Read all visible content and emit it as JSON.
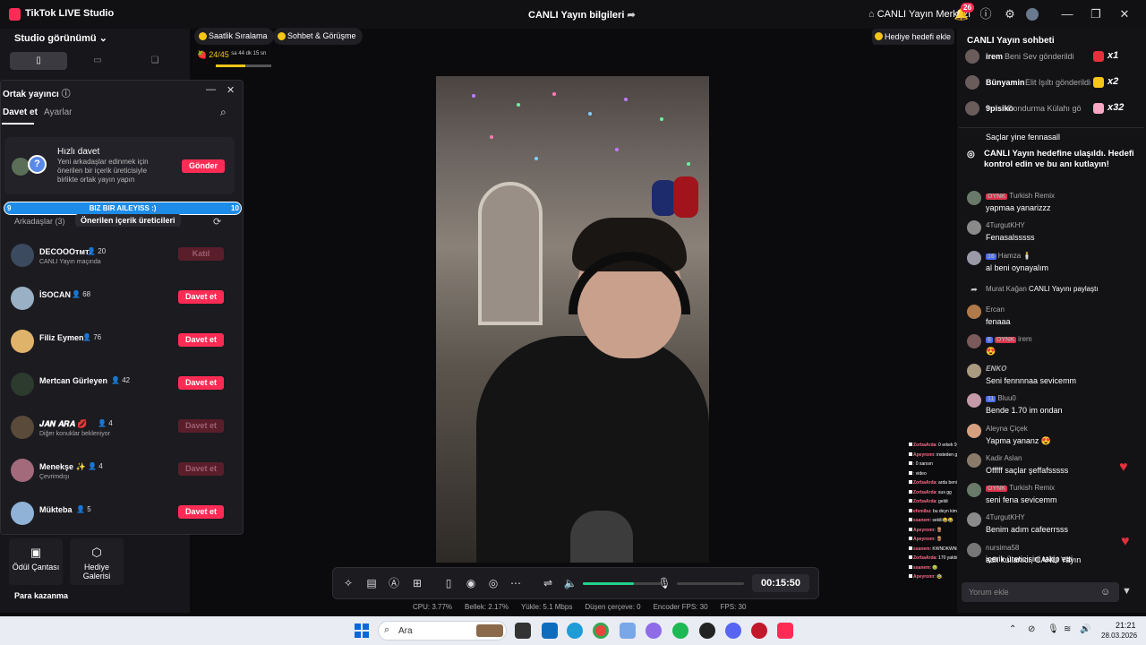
{
  "window": {
    "app_title": "TikTok LIVE Studio",
    "live_info": "CANLI Yayın bilgileri",
    "live_center": "CANLI Yayın Merkezi",
    "notification_count": "26"
  },
  "left": {
    "studio_view": "Studio görünümü",
    "chips": [
      "Saatlik Sıralama",
      "Sohbet & Görüşme"
    ],
    "goal_counter": "24/45",
    "goal_timer": "sa 44 dk 15 sn",
    "goal_progress": 0.53
  },
  "cohost": {
    "title": "Ortak yayıncı",
    "tabs": [
      "Davet et",
      "Ayarlar"
    ],
    "quick_invite": {
      "title": "Hızlı davet",
      "description": "Yeni arkadaşlar edinmek için önerilen bir içerik üreticisiyle birlikte ortak yayın yapın",
      "button": "Gönder"
    },
    "family_bar": {
      "label": "BIZ BIR AILEYISS :)",
      "left": "9",
      "right": "10"
    },
    "list_tabs": [
      "Arkadaşlar (3)",
      "Önerilen içerik üreticileri"
    ],
    "creators": [
      {
        "name": "DECOOOᴛᴍᴛᴇ",
        "count": "20",
        "sub": "CANLI Yayın maçında",
        "button": "Katıl",
        "enabled": false,
        "color": "#3b4a5e"
      },
      {
        "name": "İSOCAN",
        "count": "68",
        "sub": "",
        "button": "Davet et",
        "enabled": true,
        "color": "#9ab0c4"
      },
      {
        "name": "Filiz Eymen",
        "count": "76",
        "sub": "",
        "button": "Davet et",
        "enabled": true,
        "color": "#e0b36a"
      },
      {
        "name": "Mertcan Gürleyen",
        "count": "42",
        "sub": "",
        "button": "Davet et",
        "enabled": true,
        "color": "#2c3b2e"
      },
      {
        "name": "𝑱𝑨𝑵 𝑨𝑹𝑨 💋",
        "count": "4",
        "sub": "Diğer konuklar bekleniyor",
        "button": "Davet et",
        "enabled": false,
        "color": "#5a4a3a"
      },
      {
        "name": "Menekşe ✨",
        "count": "4",
        "sub": "Çevrimdışı",
        "button": "Davet et",
        "enabled": false,
        "color": "#a26a7a"
      },
      {
        "name": "Mükteba",
        "count": "5",
        "sub": "",
        "button": "Davet et",
        "enabled": true,
        "color": "#8fb2d6"
      }
    ]
  },
  "tools": {
    "chest": "Ödül Çantası",
    "gallery": "Hediye Galerisi",
    "earn_title": "Para kazanma"
  },
  "controls": {
    "timer": "00:15:50",
    "volume_level": 0.65,
    "stats": [
      "CPU: 3.77%",
      "Bellek: 2.17%",
      "Yükle: 5.1 Mbps",
      "Düşen çerçeve: 0",
      "Encoder FPS: 30",
      "FPS: 30"
    ]
  },
  "overlay_chat": [
    {
      "name": "ZorbaArda",
      "text": ": 0 erkek 9 kadın"
    },
    {
      "name": "Apeyronn",
      "text": ": insteden gördüğümüz dans videoyu efeme😊"
    },
    {
      "name": "",
      "text": ": 0 sarısın"
    },
    {
      "name": "",
      "text": ": video"
    },
    {
      "name": "ZorbaArda",
      "text": ": arda beni sev anıyo"
    },
    {
      "name": "ZorbaArda",
      "text": ": sus gg"
    },
    {
      "name": "ZorbaArda",
      "text": ": geldi"
    },
    {
      "name": "efemibu",
      "text": ": bu deyn kim"
    },
    {
      "name": "ssanem",
      "text": ": sekili😂😂"
    },
    {
      "name": "Apeyronn",
      "text": ": 🪵"
    },
    {
      "name": "Apeyronn",
      "text": ": 🪵"
    },
    {
      "name": "ssanem",
      "text": ": KWNDKWNFKWNKDMWR"
    },
    {
      "name": "ZorbaArda",
      "text": ": 170 yakbiş 1.53"
    },
    {
      "name": "ssanem",
      "text": ": 🤢"
    },
    {
      "name": "Apeyronn",
      "text": ": 🥸"
    }
  ],
  "chat": {
    "gift_goal_add": "Hediye hedefi ekle",
    "title": "CANLI Yayın sohbeti",
    "gifts": [
      {
        "name": "irem",
        "text": "Beni Sev gönderildi",
        "mult": "x1",
        "color": "#e5303c"
      },
      {
        "name": "Bünyamin",
        "text": "Elit Işıltı gönderildi",
        "mult": "x2",
        "color": "#f5c518"
      },
      {
        "name": "9pisiko",
        "text": "Dondurma Külahı gö",
        "mult": "x32",
        "color": "#f7a6c3"
      }
    ],
    "top_text": "Saçlar yine fennasall",
    "goal_notice": "CANLI Yayın hedefine ulaşıldı. Hedefi kontrol edin ve bu anı kutlayın!",
    "messages": [
      {
        "badge": "OYNK",
        "badge2": "",
        "user": "Turkish Remix",
        "text": "yapmaa yanarizzz"
      },
      {
        "badge": "",
        "badge2": "",
        "user": "4TurgutKHY",
        "text": "Fenasalsssss"
      },
      {
        "badge": "16",
        "badge2": "",
        "user": "Hamza 🕯️",
        "text": "al beni oynayalım"
      },
      {
        "badge": "",
        "badge2": "",
        "user": "Murat Kağan",
        "text": "CANLI Yayını paylaştı"
      },
      {
        "badge": "",
        "badge2": "",
        "user": "Ercan",
        "text": "fenaaa"
      },
      {
        "badge": "6",
        "badge2": "OYNK",
        "user": "irem",
        "text": "😍"
      },
      {
        "badge": "",
        "badge2": "",
        "user": "𝑬𝑵𝑲𝑶",
        "text": "Seni fennnnaa sevicemm"
      },
      {
        "badge": "11",
        "badge2": "",
        "user": "Bluu0",
        "text": "Bende 1.70 im ondan"
      },
      {
        "badge": "",
        "badge2": "",
        "user": "Aleyna Çiçek",
        "text": "Yapma yananz 😍"
      },
      {
        "badge": "",
        "badge2": "",
        "user": "Kadir Aslan",
        "text": "Offfff saçlar şeffafsssss"
      },
      {
        "badge": "OYNK",
        "badge2": "",
        "user": "Turkish Remix",
        "text": "seni fena sevicemm"
      },
      {
        "badge": "",
        "badge2": "",
        "user": "4TurgutKHY",
        "text": "Benim adım cafeerrsss"
      },
      {
        "badge": "",
        "badge2": "",
        "user": "nursima58",
        "text": "adlı kullanıcı, CANLI Yayın"
      }
    ],
    "follow_tail": "içerik üreticisini takip etti",
    "input_placeholder": "Yorum ekle"
  },
  "taskbar": {
    "search": "Ara",
    "time": "21:21",
    "date": "28.03.2026"
  }
}
